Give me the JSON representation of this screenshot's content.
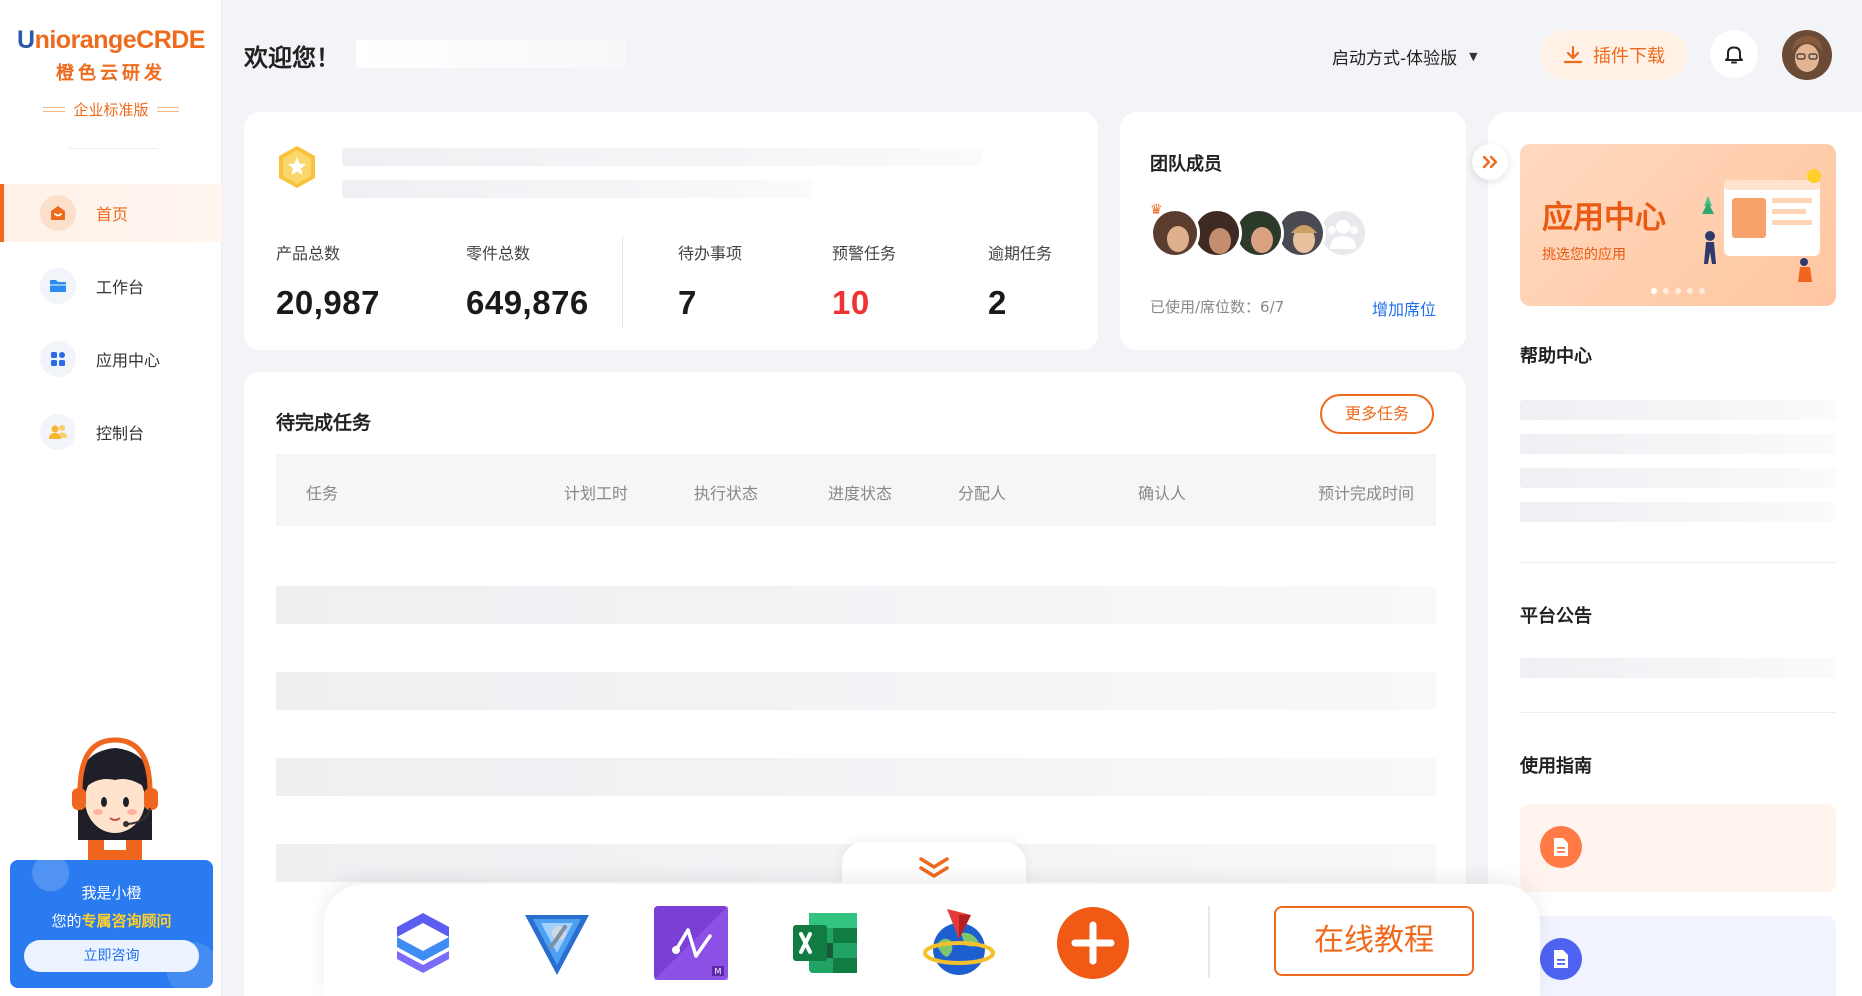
{
  "brand": {
    "logo_mark": "U",
    "logo_en": "niorangeCRDE",
    "logo_cn": "橙色云研发",
    "edition": "企业标准版",
    "accent": "#ef6a1d",
    "blue": "#2c5aa8"
  },
  "sidebar": {
    "items": [
      {
        "label": "首页",
        "icon": "home-icon",
        "active": true
      },
      {
        "label": "工作台",
        "icon": "folder-icon",
        "active": false
      },
      {
        "label": "应用中心",
        "icon": "apps-grid-icon",
        "active": false
      },
      {
        "label": "控制台",
        "icon": "users-icon",
        "active": false
      }
    ]
  },
  "assistant": {
    "name": "我是小橙",
    "line_prefix": "您的",
    "line_highlight": "专属咨询顾问",
    "button": "立即咨询"
  },
  "header": {
    "welcome": "欢迎您！",
    "launch_mode": "启动方式-体验版",
    "plugin_download": "插件下载"
  },
  "stats": {
    "items": [
      {
        "label": "产品总数",
        "value": "20,987",
        "warn": false
      },
      {
        "label": "零件总数",
        "value": "649,876",
        "warn": false
      },
      {
        "label": "待办事项",
        "value": "7",
        "warn": false
      },
      {
        "label": "预警任务",
        "value": "10",
        "warn": true
      },
      {
        "label": "逾期任务",
        "value": "2",
        "warn": false
      }
    ]
  },
  "team": {
    "title": "团队成员",
    "seats": "已使用/席位数：6/7",
    "add_seat": "增加席位"
  },
  "tasks": {
    "title": "待完成任务",
    "more": "更多任务",
    "columns": [
      "任务",
      "计划工时",
      "执行状态",
      "进度状态",
      "分配人",
      "确认人",
      "预计完成时间"
    ]
  },
  "right_panel": {
    "banner_title": "应用中心",
    "banner_sub": "挑选您的应用",
    "help_center": "帮助中心",
    "announcements": "平台公告",
    "guide": "使用指南"
  },
  "dock": {
    "tutorial": "在线教程"
  }
}
